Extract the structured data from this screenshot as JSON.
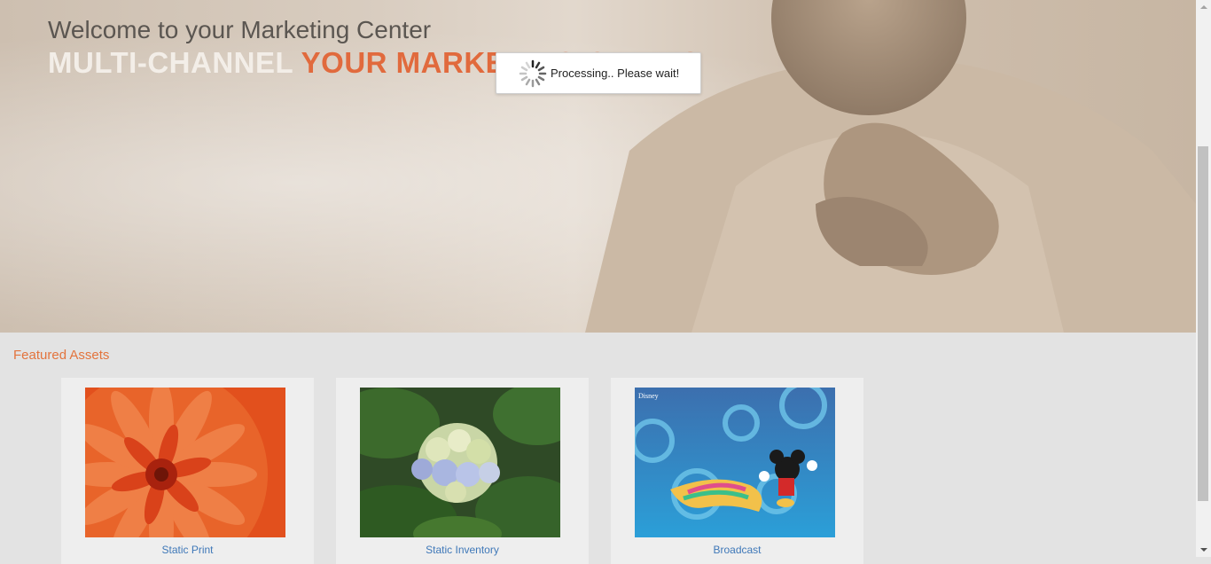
{
  "hero": {
    "subtitle": "Welcome to your Marketing Center",
    "title_part1": "MULTI-CHANNEL",
    "title_part2": "YOUR MARKETING GENIUS"
  },
  "processing_dialog": {
    "message": "Processing.. Please wait!"
  },
  "featured": {
    "heading": "Featured Assets",
    "items": [
      {
        "label": "Static Print",
        "image": "orange-chrysanthemum"
      },
      {
        "label": "Static Inventory",
        "image": "hydrangea-flower"
      },
      {
        "label": "Broadcast",
        "image": "mickey-mouse-art"
      }
    ]
  },
  "colors": {
    "accent": "#e16a3d",
    "link": "#3f78b8",
    "background": "#e3e3e3"
  }
}
